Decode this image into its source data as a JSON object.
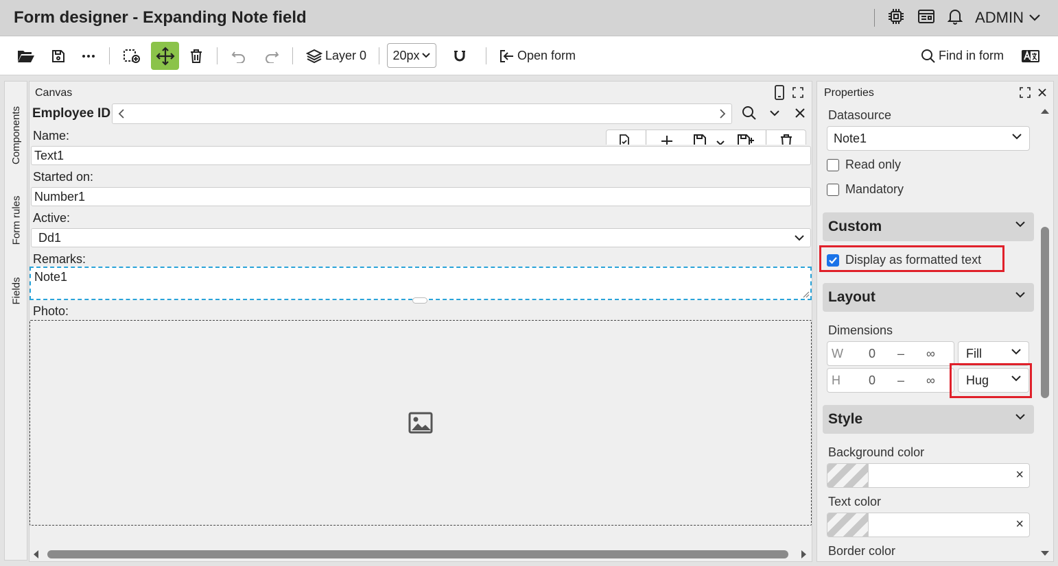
{
  "app": {
    "title": "Form designer - Expanding Note field",
    "user": "ADMIN"
  },
  "icons": {
    "title_bar": [
      "chip-icon",
      "news-icon",
      "bell-icon"
    ]
  },
  "toolbar": {
    "layer_label": "Layer 0",
    "grid_size": "20px",
    "open_form_label": "Open form",
    "find_label": "Find in form"
  },
  "side_tabs": [
    "Components",
    "Form rules",
    "Fields"
  ],
  "canvas": {
    "panel_title": "Canvas",
    "nav_label": "Employee ID",
    "fields": [
      {
        "label": "Name:",
        "value": "Text1"
      },
      {
        "label": "Started on:",
        "value": "Number1"
      },
      {
        "label": "Active:",
        "value": "Dd1"
      },
      {
        "label": "Remarks:",
        "value": "Note1"
      },
      {
        "label": "Photo:"
      }
    ]
  },
  "properties": {
    "panel_title": "Properties",
    "datasource_label": "Datasource",
    "datasource_value": "Note1",
    "read_only_label": "Read only",
    "read_only_checked": false,
    "mandatory_label": "Mandatory",
    "mandatory_checked": false,
    "custom_section": "Custom",
    "formatted_text_label": "Display as formatted text",
    "formatted_text_checked": true,
    "layout_section": "Layout",
    "dimensions_label": "Dimensions",
    "width": {
      "axis": "W",
      "min": "0",
      "sep": "–",
      "max": "∞",
      "mode": "Fill"
    },
    "height": {
      "axis": "H",
      "min": "0",
      "sep": "–",
      "max": "∞",
      "mode": "Hug"
    },
    "style_section": "Style",
    "bg_color_label": "Background color",
    "text_color_label": "Text color",
    "border_color_label": "Border color",
    "clear_glyph": "×"
  },
  "colors": {
    "accent_green": "#8bc34a",
    "selection_blue": "#29a3d9",
    "highlight_red": "#e0202a",
    "checkbox_blue": "#1a73e8"
  }
}
